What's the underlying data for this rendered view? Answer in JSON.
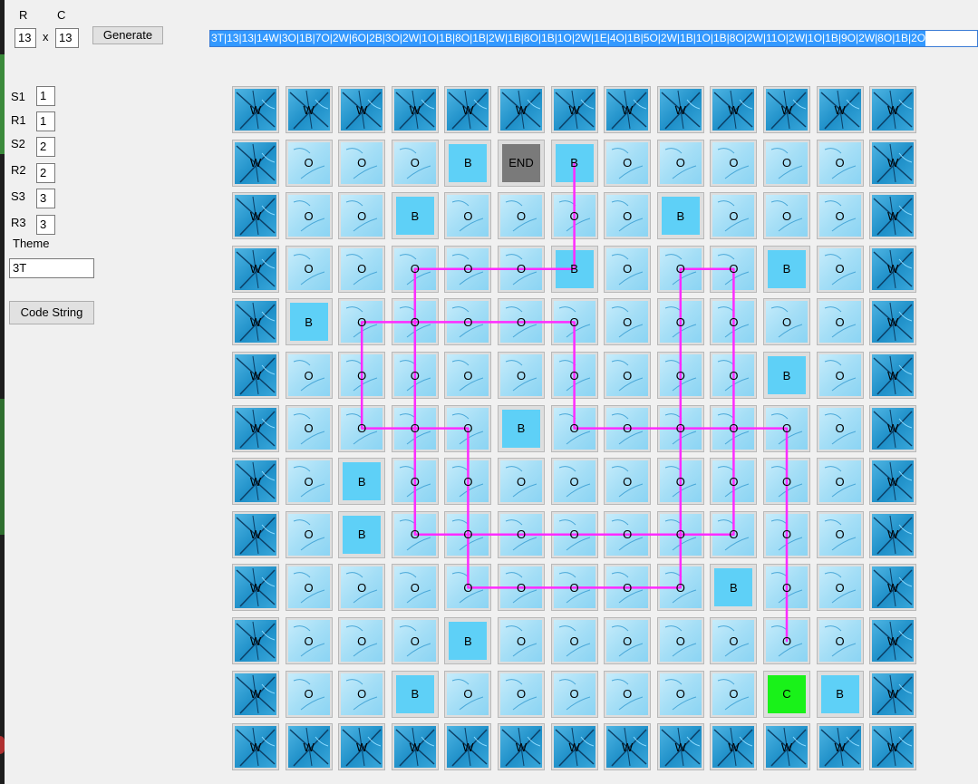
{
  "controls": {
    "rows_label": "R",
    "cols_label": "C",
    "rows_value": "13",
    "times_sign": "x",
    "cols_value": "13",
    "generate_label": "Generate",
    "code_string_value": "3T|13|13|14W|3O|1B|7O|2W|6O|2B|3O|2W|1O|1B|8O|1B|2W|1B|8O|1B|1O|2W|1E|4O|1B|5O|2W|1B|1O|1B|8O|2W|11O|2W|1O|1B|9O|2W|8O|1B|2O",
    "s1_label": "S1",
    "s1_value": "1",
    "r1_label": "R1",
    "r1_value": "1",
    "s2_label": "S2",
    "s2_value": "2",
    "r2_label": "R2",
    "r2_value": "2",
    "s3_label": "S3",
    "s3_value": "3",
    "r3_label": "R3",
    "r3_value": "3",
    "theme_label": "Theme",
    "theme_value": "3T",
    "code_string_button_label": "Code String"
  },
  "colors": {
    "wall": "#1e8fc8",
    "open": "#a4def6",
    "block": "#5ed0f7",
    "cart": "#19f219",
    "end": "#7a7a7a",
    "path": "#ff2bff"
  },
  "grid": {
    "rows": 13,
    "cols": 13,
    "cells": [
      [
        "W",
        "W",
        "W",
        "W",
        "W",
        "W",
        "W",
        "W",
        "W",
        "W",
        "W",
        "W",
        "W"
      ],
      [
        "W",
        "O",
        "O",
        "O",
        "B",
        "END",
        "B",
        "O",
        "O",
        "O",
        "O",
        "O",
        "W"
      ],
      [
        "W",
        "O",
        "O",
        "B",
        "O",
        "O",
        "O",
        "O",
        "B",
        "O",
        "O",
        "O",
        "W"
      ],
      [
        "W",
        "O",
        "O",
        "O",
        "O",
        "O",
        "B",
        "O",
        "O",
        "O",
        "B",
        "O",
        "W"
      ],
      [
        "W",
        "B",
        "O",
        "O",
        "O",
        "O",
        "O",
        "O",
        "O",
        "O",
        "O",
        "O",
        "W"
      ],
      [
        "W",
        "O",
        "O",
        "O",
        "O",
        "O",
        "O",
        "O",
        "O",
        "O",
        "B",
        "O",
        "W"
      ],
      [
        "W",
        "O",
        "O",
        "O",
        "O",
        "B",
        "O",
        "O",
        "O",
        "O",
        "O",
        "O",
        "W"
      ],
      [
        "W",
        "O",
        "B",
        "O",
        "O",
        "O",
        "O",
        "O",
        "O",
        "O",
        "O",
        "O",
        "W"
      ],
      [
        "W",
        "O",
        "B",
        "O",
        "O",
        "O",
        "O",
        "O",
        "O",
        "O",
        "O",
        "O",
        "W"
      ],
      [
        "W",
        "O",
        "O",
        "O",
        "O",
        "O",
        "O",
        "O",
        "O",
        "B",
        "O",
        "O",
        "W"
      ],
      [
        "W",
        "O",
        "O",
        "O",
        "B",
        "O",
        "O",
        "O",
        "O",
        "O",
        "O",
        "O",
        "W"
      ],
      [
        "W",
        "O",
        "O",
        "B",
        "O",
        "O",
        "O",
        "O",
        "O",
        "O",
        "C",
        "B",
        "W"
      ],
      [
        "W",
        "W",
        "W",
        "W",
        "W",
        "W",
        "W",
        "W",
        "W",
        "W",
        "W",
        "W",
        "W"
      ]
    ]
  },
  "drawn_path": {
    "color": "#ff2bff",
    "cells": [
      [
        10,
        10
      ],
      [
        6,
        10
      ],
      [
        6,
        6
      ],
      [
        4,
        6
      ],
      [
        4,
        2
      ],
      [
        6,
        2
      ],
      [
        6,
        4
      ],
      [
        9,
        4
      ],
      [
        9,
        8
      ],
      [
        6,
        8
      ],
      [
        3,
        8
      ],
      [
        3,
        9
      ],
      [
        8,
        9
      ],
      [
        8,
        3
      ],
      [
        3,
        3
      ],
      [
        3,
        6
      ],
      [
        1,
        6
      ]
    ]
  }
}
